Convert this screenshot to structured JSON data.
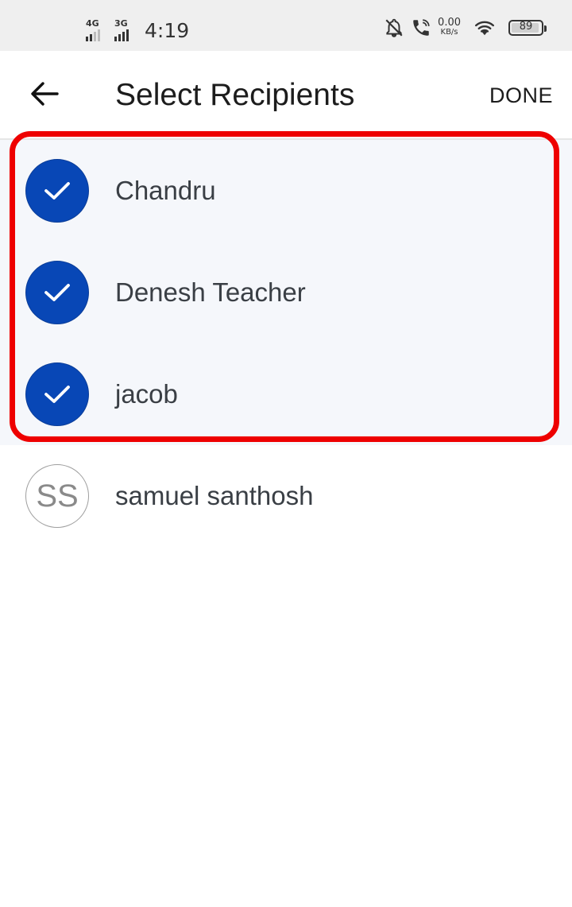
{
  "status_bar": {
    "net1_label": "4G",
    "net2_label": "3G",
    "time": "4:19",
    "speed_value": "0.00",
    "speed_unit": "KB/s",
    "battery": "89"
  },
  "header": {
    "title": "Select Recipients",
    "done_label": "DONE",
    "back_icon": "arrow-left-icon"
  },
  "recipients": [
    {
      "name": "Chandru",
      "selected": true
    },
    {
      "name": "Denesh Teacher",
      "selected": true
    },
    {
      "name": "jacob",
      "selected": true
    },
    {
      "name": "samuel santhosh",
      "selected": false,
      "initials": "SS"
    }
  ],
  "colors": {
    "accent": "#0847b6",
    "selected_row_bg": "#f5f7fb",
    "highlight": "#ee0000"
  }
}
